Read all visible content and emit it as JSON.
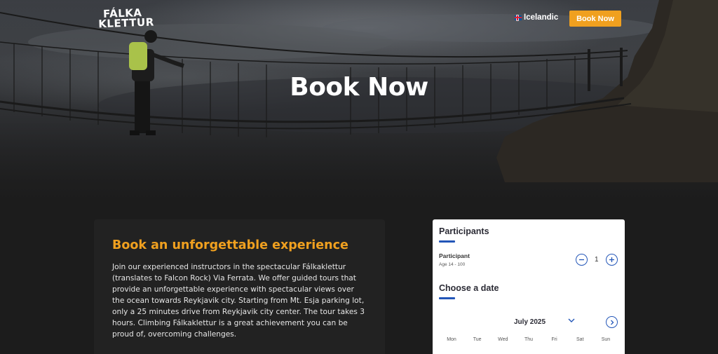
{
  "header": {
    "logo_line1": "FÁLKA",
    "logo_line2": "KLETTUR",
    "language_label": "Icelandic",
    "book_button_label": "Book Now"
  },
  "hero": {
    "title": "Book Now"
  },
  "info": {
    "title": "Book an unforgettable experience",
    "body": "Join our experienced instructors in the spectacular Fálkaklettur (translates to Falcon Rock) Via Ferrata. We offer guided tours that provide an unforgettable experience with spectacular views over the ocean towards Reykjavik city. Starting from Mt. Esja parking lot, only a 25 minutes drive from Reykjavik city center. The tour takes 3 hours. Climbing Fálkaklettur is a great achievement you can be proud of, overcoming challenges."
  },
  "booking": {
    "participants_heading": "Participants",
    "participant_label": "Participant",
    "participant_age": "Age 14 - 100",
    "quantity": "1",
    "date_heading": "Choose a date",
    "month_label": "July 2025",
    "weekdays": [
      "Mon",
      "Tue",
      "Wed",
      "Thu",
      "Fri",
      "Sat",
      "Sun"
    ]
  },
  "colors": {
    "accent": "#f0a01f",
    "blue": "#2356b8",
    "background": "#1c1c1c"
  }
}
